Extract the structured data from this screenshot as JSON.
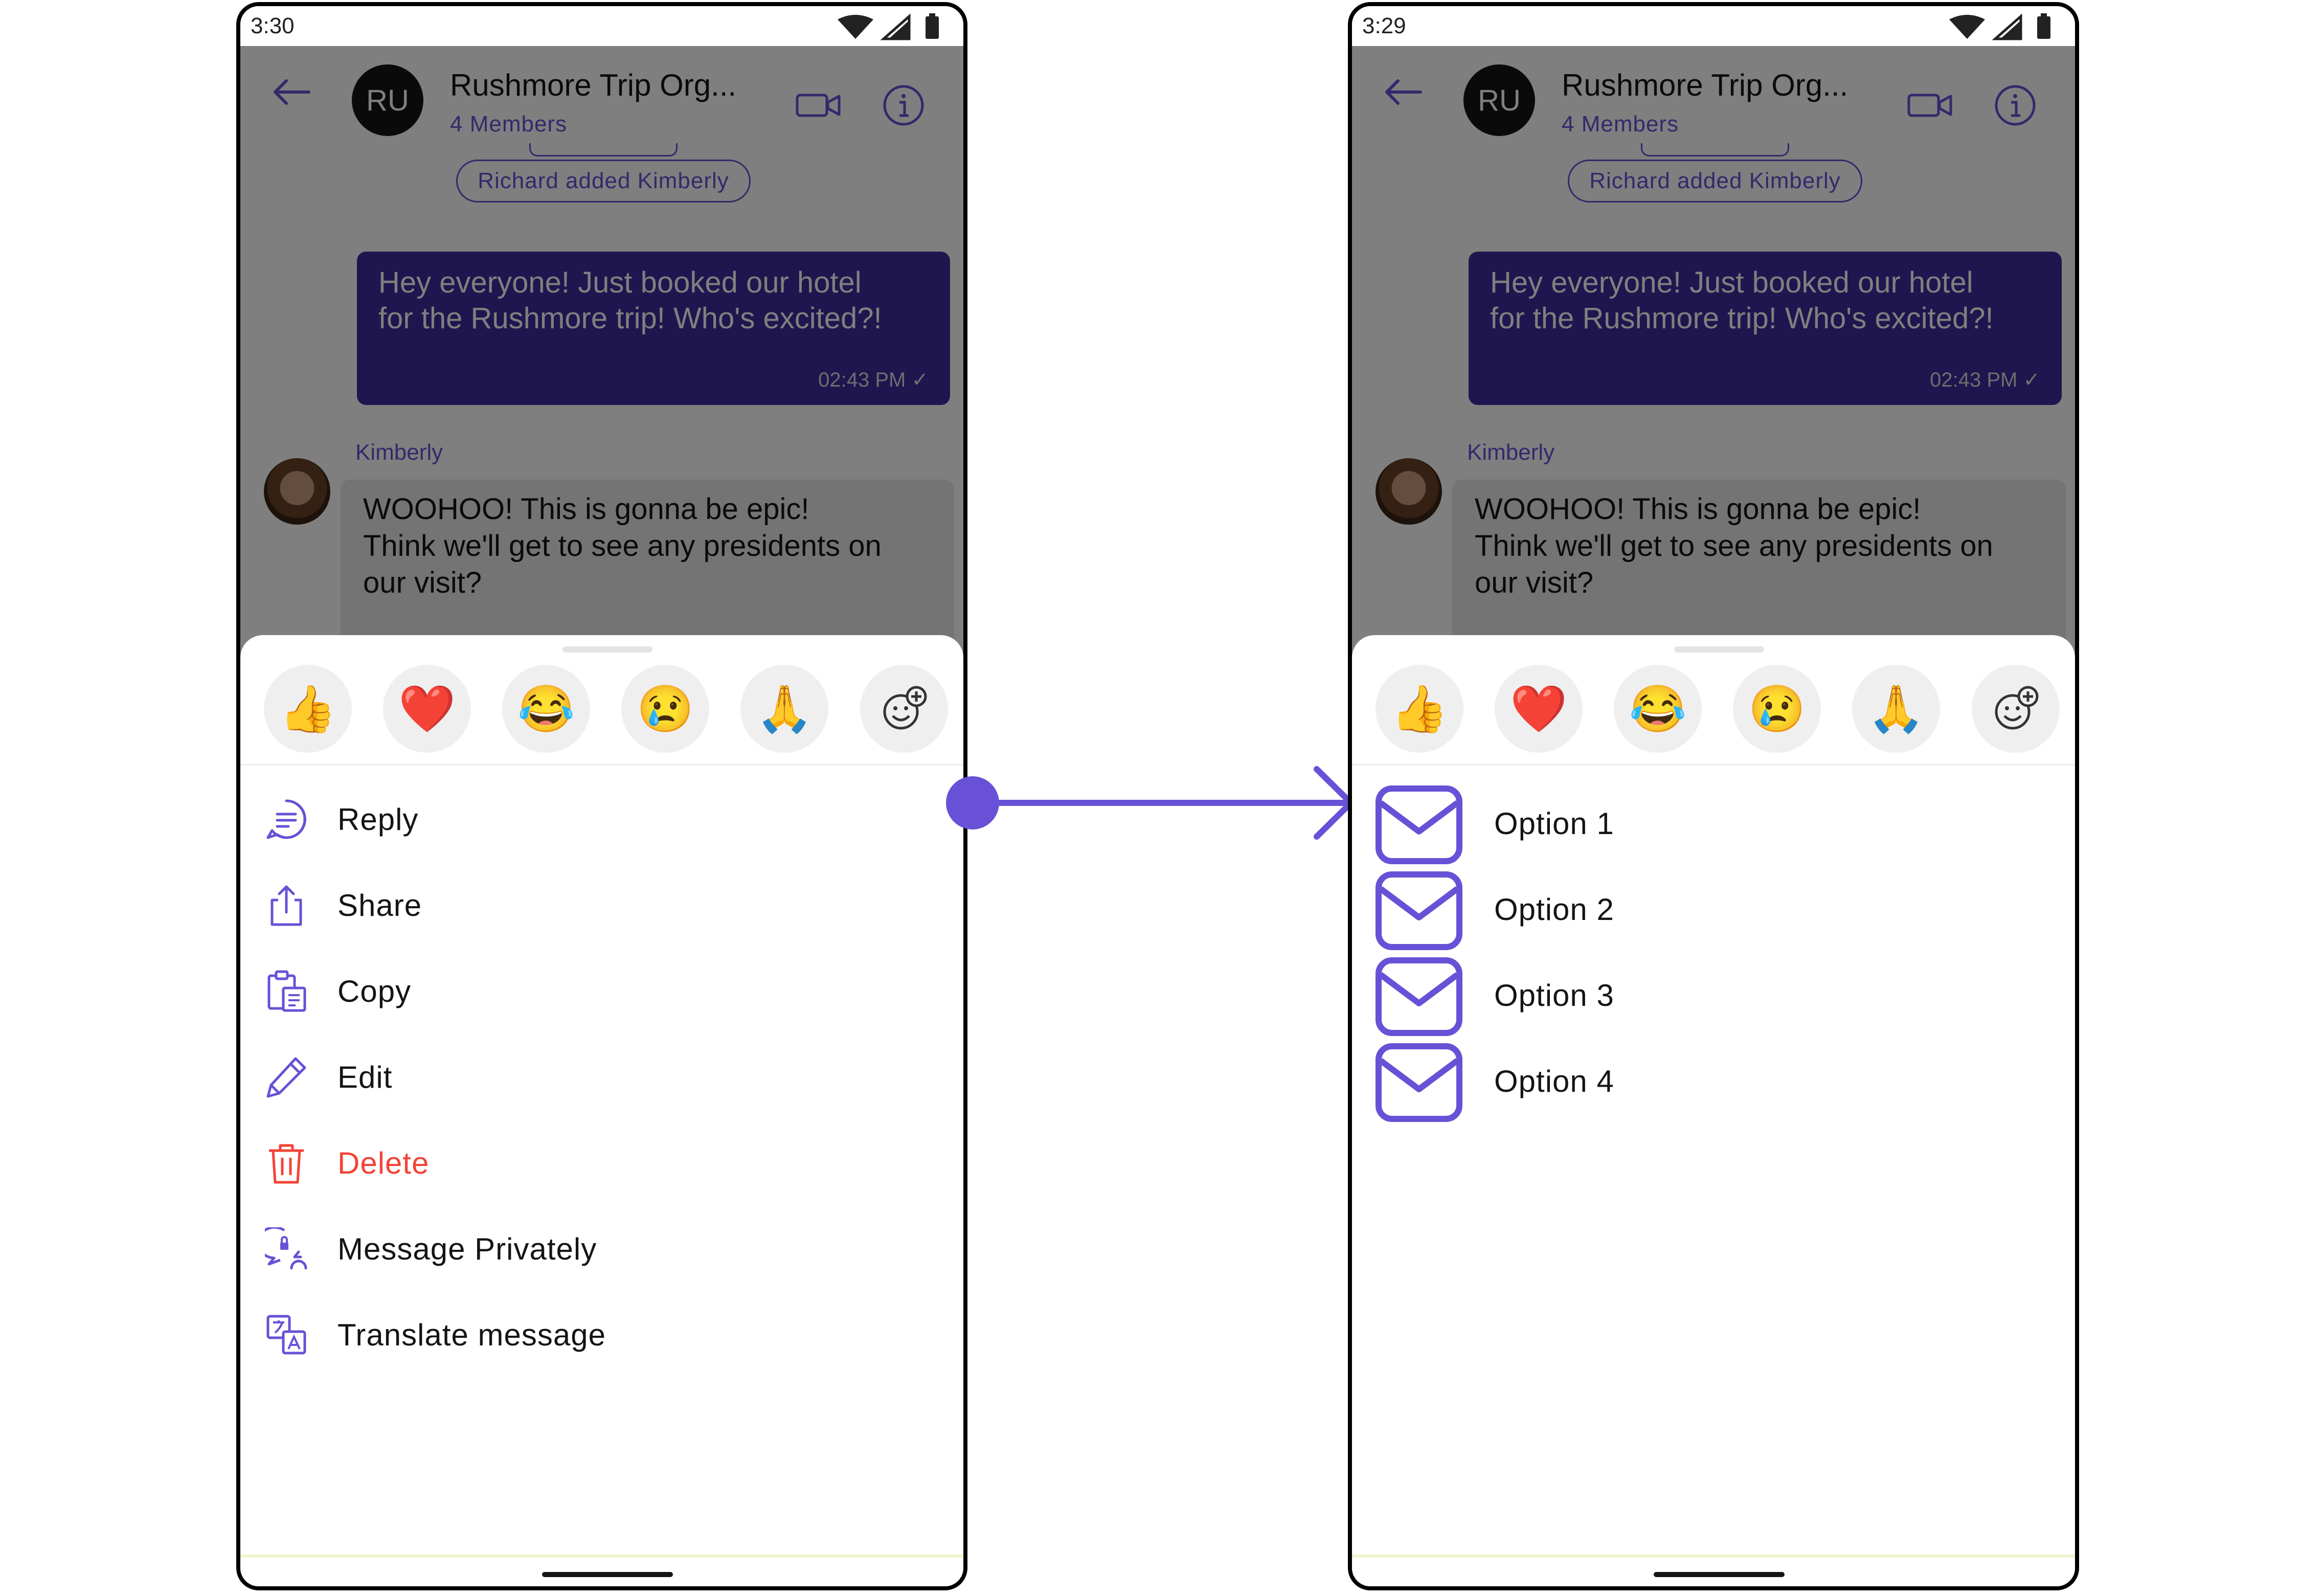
{
  "colors": {
    "accent": "#6851d6",
    "outgoing_bubble": "#3e2c9e",
    "danger": "#f44336"
  },
  "left": {
    "status_time": "3:30",
    "header": {
      "avatar_initials": "RU",
      "group_name": "Rushmore Trip Org...",
      "members": "4 Members"
    },
    "action_pill": "Richard added Kimberly",
    "outgoing_message": {
      "text": "Hey everyone!  Just booked our hotel\nfor the Rushmore trip!  Who's excited?!",
      "time": "02:43 PM"
    },
    "incoming_message": {
      "sender": "Kimberly",
      "text": "WOOHOO!  This is gonna be epic!\nThink we'll get to see any presidents on\nour visit?"
    },
    "reactions": [
      "👍",
      "❤️",
      "😂",
      "😢",
      "🙏",
      "add-reaction-icon"
    ],
    "menu": [
      {
        "label": "Reply",
        "icon": "reply-icon"
      },
      {
        "label": "Share",
        "icon": "share-icon"
      },
      {
        "label": "Copy",
        "icon": "copy-icon"
      },
      {
        "label": "Edit",
        "icon": "edit-icon"
      },
      {
        "label": "Delete",
        "icon": "delete-icon"
      },
      {
        "label": "Message Privately",
        "icon": "message-privately-icon"
      },
      {
        "label": "Translate message",
        "icon": "translate-icon"
      }
    ]
  },
  "right": {
    "status_time": "3:29",
    "header": {
      "avatar_initials": "RU",
      "group_name": "Rushmore Trip Org...",
      "members": "4 Members"
    },
    "action_pill": "Richard added Kimberly",
    "outgoing_message": {
      "text": "Hey everyone!  Just booked our hotel\nfor the Rushmore trip!  Who's excited?!",
      "time": "02:43 PM"
    },
    "incoming_message": {
      "sender": "Kimberly",
      "text": "WOOHOO!  This is gonna be epic!\nThink we'll get to see any presidents on\nour visit?"
    },
    "reactions": [
      "👍",
      "❤️",
      "😂",
      "😢",
      "🙏",
      "add-reaction-icon"
    ],
    "options": [
      {
        "label": "Option 1",
        "icon": "mail-icon"
      },
      {
        "label": "Option 2",
        "icon": "mail-icon"
      },
      {
        "label": "Option 3",
        "icon": "mail-icon"
      },
      {
        "label": "Option 4",
        "icon": "mail-icon"
      }
    ]
  }
}
